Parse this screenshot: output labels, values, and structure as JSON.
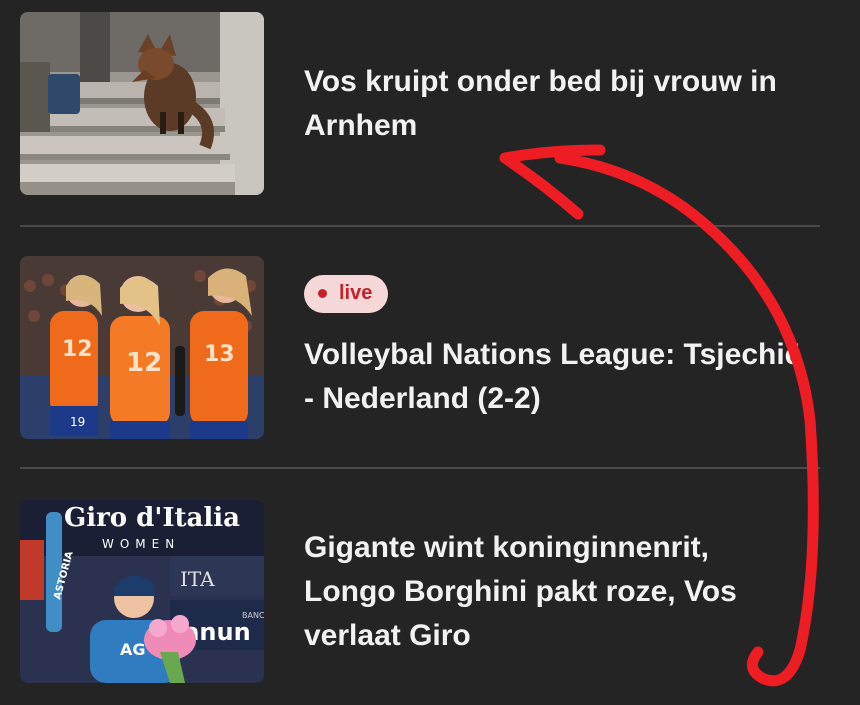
{
  "articles": [
    {
      "headline": "Vos kruipt onder bed bij vrouw in Arnhem",
      "thumbnail": "fox-on-stairs"
    },
    {
      "badge": "live",
      "headline": "Volleybal Nations League: Tsjechië - Nederland (2-2)",
      "thumbnail": "volleyball-players-celebrating",
      "thumb_text": {
        "jersey_a": "12",
        "jersey_b": "12",
        "jersey_c": "13",
        "jersey_d": "19"
      }
    },
    {
      "headline": "Gigante wint koninginnenrit, Longo Borghini pakt roze, Vos verlaat Giro",
      "thumbnail": "cyclist-on-podium",
      "thumb_text": {
        "banner_title": "Giro d'Italia",
        "banner_sub": "WOMEN",
        "sponsor": "ITA",
        "sponsor2": "lanun",
        "sponsor2_small": "BANC",
        "sleeve": "ASTORIA",
        "jersey_logo": "AG"
      }
    }
  ],
  "colors": {
    "background": "#242424",
    "divider": "#4a4a4a",
    "live_badge_bg": "#f7d8d8",
    "live_badge_text": "#c4212b",
    "annotation": "#ee1d23"
  },
  "annotation": {
    "icon": "curved-arrow-icon"
  }
}
